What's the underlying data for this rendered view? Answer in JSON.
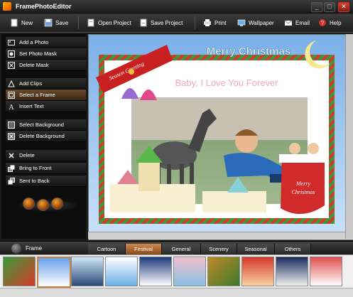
{
  "window": {
    "title": "FramePhotoEditor",
    "minimize": "_",
    "maximize": "□",
    "close": "✕"
  },
  "toolbar": {
    "new": "New",
    "save": "Save",
    "open_project": "Open Project",
    "save_project": "Save Project",
    "print": "Print",
    "wallpaper": "Wallpaper",
    "email": "Email",
    "help": "Help"
  },
  "sidebar": {
    "items": [
      {
        "label": "Add a Photo",
        "icon": "photo-icon"
      },
      {
        "label": "Set Photo Mask",
        "icon": "mask-icon"
      },
      {
        "label": "Delete Mask",
        "icon": "delete-mask-icon"
      },
      {
        "label": "Add Clips",
        "icon": "clip-icon"
      },
      {
        "label": "Select a Frame",
        "icon": "frame-icon"
      },
      {
        "label": "Insert Text",
        "icon": "text-icon"
      },
      {
        "label": "Select Background",
        "icon": "background-icon"
      },
      {
        "label": "Delete Background",
        "icon": "delete-background-icon"
      },
      {
        "label": "Delete",
        "icon": "close-icon"
      },
      {
        "label": "Bring to Front",
        "icon": "bring-front-icon"
      },
      {
        "label": "Sent to Back",
        "icon": "send-back-icon"
      }
    ],
    "active_index": 4
  },
  "canvas": {
    "greeting_ribbon": "Season Greeting",
    "header": "Merry Christmas",
    "caption": "Baby, I Love You Forever",
    "stocking_text_1": "Merry",
    "stocking_text_2": "Christmas"
  },
  "bottom": {
    "panel_label": "Frame",
    "tabs": [
      "Cartoon",
      "Festival",
      "General",
      "Scenery",
      "Seasonal",
      "Others"
    ],
    "active_tab": "Festival"
  },
  "colors": {
    "accent": "#c8823f",
    "frame_red": "#d63a2a",
    "frame_green": "#3a9a3a",
    "title_blue": "#5a9ad8"
  }
}
